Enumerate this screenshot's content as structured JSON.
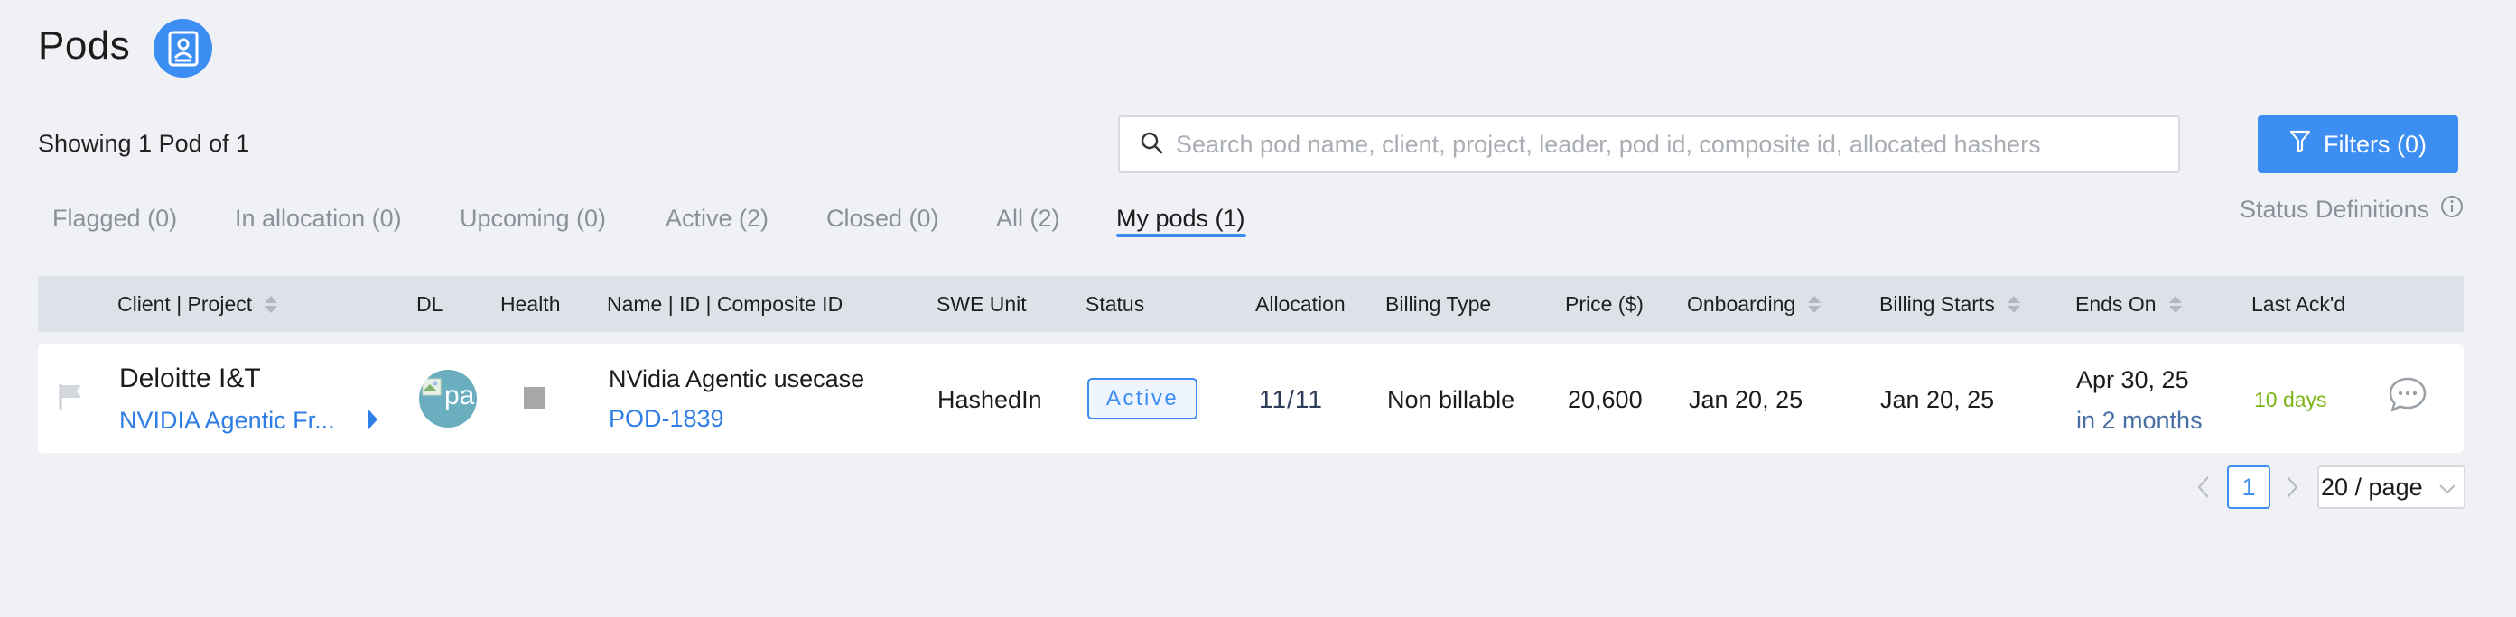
{
  "header": {
    "title": "Pods",
    "badge_icon": "contact-book-icon",
    "accent": "#3d8ef2"
  },
  "summary": {
    "showing_text": "Showing 1 Pod of 1"
  },
  "search": {
    "placeholder": "Search pod name, client, project, leader, pod id, composite id, allocated hashers",
    "value": ""
  },
  "filters": {
    "label": "Filters (0)"
  },
  "tabs": [
    {
      "label": "Flagged (0)"
    },
    {
      "label": "In allocation (0)"
    },
    {
      "label": "Upcoming (0)"
    },
    {
      "label": "Active (2)"
    },
    {
      "label": "Closed (0)"
    },
    {
      "label": "All (2)"
    },
    {
      "label": "My pods (1)",
      "active": true
    }
  ],
  "status_definitions": {
    "label": "Status Definitions"
  },
  "table": {
    "columns": [
      {
        "label": "Client | Project",
        "sortable": true
      },
      {
        "label": "DL"
      },
      {
        "label": "Health"
      },
      {
        "label": "Name | ID | Composite ID"
      },
      {
        "label": "SWE Unit"
      },
      {
        "label": "Status"
      },
      {
        "label": "Allocation"
      },
      {
        "label": "Billing Type"
      },
      {
        "label": "Price ($)"
      },
      {
        "label": "Onboarding",
        "sortable": true
      },
      {
        "label": "Billing Starts",
        "sortable": true
      },
      {
        "label": "Ends On",
        "sortable": true
      },
      {
        "label": "Last Ack'd"
      }
    ],
    "rows": [
      {
        "client": "Deloitte I&T",
        "project": "NVIDIA Agentic Fr...",
        "dl_avatar_text": "pa",
        "pod_name": "NVidia Agentic usecase",
        "pod_id": "POD-1839",
        "swe_unit": "HashedIn",
        "status": "Active",
        "allocation": "11/11",
        "billing_type": "Non billable",
        "price": "20,600",
        "onboarding": "Jan 20, 25",
        "billing_starts": "Jan 20, 25",
        "ends_on": "Apr 30, 25",
        "ends_relative": "in 2 months",
        "last_ackd": "10 days",
        "colors": {
          "status": "#3d8ef2",
          "last_ackd": "#7cb518",
          "health": "#a7a7a7"
        }
      }
    ]
  },
  "pagination": {
    "current_page": "1",
    "page_size": "20 / page"
  }
}
